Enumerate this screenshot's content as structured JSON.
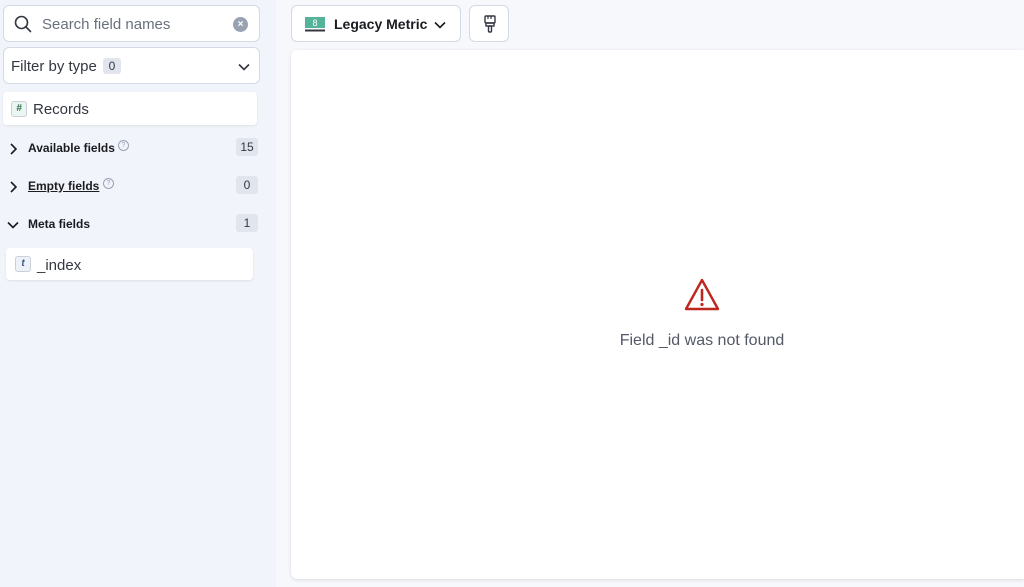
{
  "sidebar": {
    "search": {
      "placeholder": "Search field names",
      "value": ""
    },
    "filter": {
      "label": "Filter by type",
      "count": "0"
    },
    "top_field": {
      "type_glyph": "#",
      "name": "Records"
    },
    "sections": [
      {
        "title": "Available fields",
        "count": "15",
        "expanded": false
      },
      {
        "title": "Empty fields",
        "count": "0",
        "expanded": false
      },
      {
        "title": "Meta fields",
        "count": "1",
        "expanded": true
      }
    ],
    "meta_field": {
      "type_glyph": "t",
      "name": "_index"
    }
  },
  "toolbar": {
    "visualization": {
      "label": "Legacy Metric",
      "icon_glyph": "8",
      "icon_color": "#54b399"
    },
    "brush_button": {
      "icon": "paintbrush-icon"
    }
  },
  "workspace": {
    "error_message": "Field _id was not found",
    "error_color": "#bd271e"
  }
}
